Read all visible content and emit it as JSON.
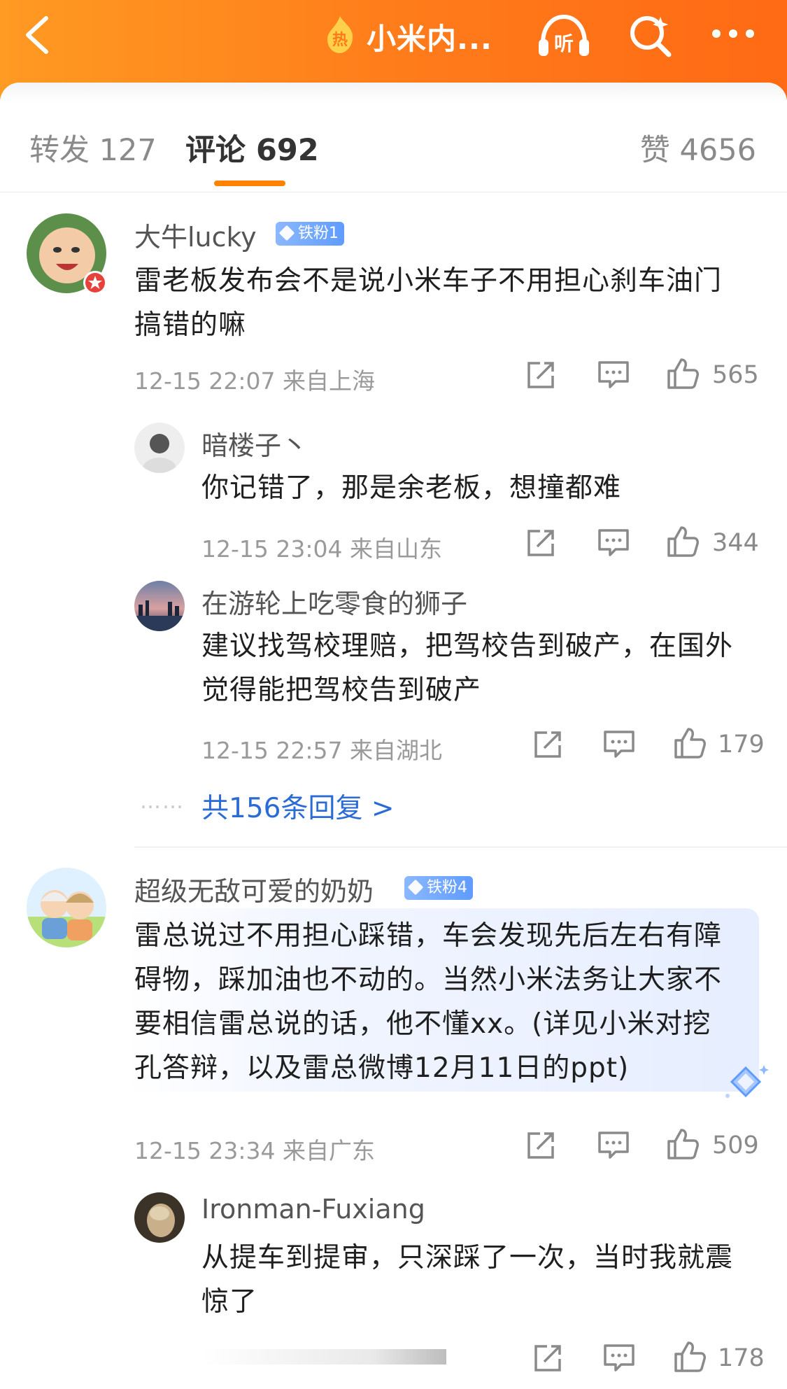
{
  "header": {
    "title": "小米内...",
    "hot_badge_text": "热",
    "listen_text": "听",
    "bg_color": "#ff7a1a"
  },
  "tabs": {
    "forward": "转发 127",
    "comments": "评论 692",
    "likes": "赞 4656",
    "active_color": "#ff8200"
  },
  "comments": [
    {
      "name": "大牛lucky",
      "badge": "铁粉1",
      "text_lines": [
        "雷老板发布会不是说小米车子不用担心刹车油门",
        "搞错的嘛"
      ],
      "meta": "12-15 22:07 来自上海",
      "like_count": "565",
      "replies": [
        {
          "name": "暗楼子丶",
          "text_lines": [
            "你记错了，那是余老板，想撞都难"
          ],
          "meta": "12-15 23:04 来自山东",
          "like_count": "344"
        },
        {
          "name": "在游轮上吃零食的狮子",
          "text_lines": [
            "建议找驾校理赔，把驾校告到破产，在国外",
            "觉得能把驾校告到破产"
          ],
          "meta": "12-15 22:57 来自湖北",
          "like_count": "179"
        }
      ],
      "more_replies": "共156条回复 >",
      "dots": "……"
    },
    {
      "name": "超级无敌可爱的奶奶",
      "badge": "铁粉4",
      "text_lines": [
        "雷总说过不用担心踩错，车会发现先后左右有障",
        "碍物，踩加油也不动的。当然小米法务让大家不",
        "要相信雷总说的话，他不懂xx。(详见小米对挖",
        "孔答辩，以及雷总微博12月11日的ppt)"
      ],
      "meta": "12-15 23:34 来自广东",
      "like_count": "509",
      "replies": [
        {
          "name": "Ironman-Fuxiang",
          "text_lines": [
            "从提车到提审，只深踩了一次，当时我就震",
            "惊了"
          ],
          "meta": "",
          "like_count": "178"
        }
      ]
    }
  ]
}
